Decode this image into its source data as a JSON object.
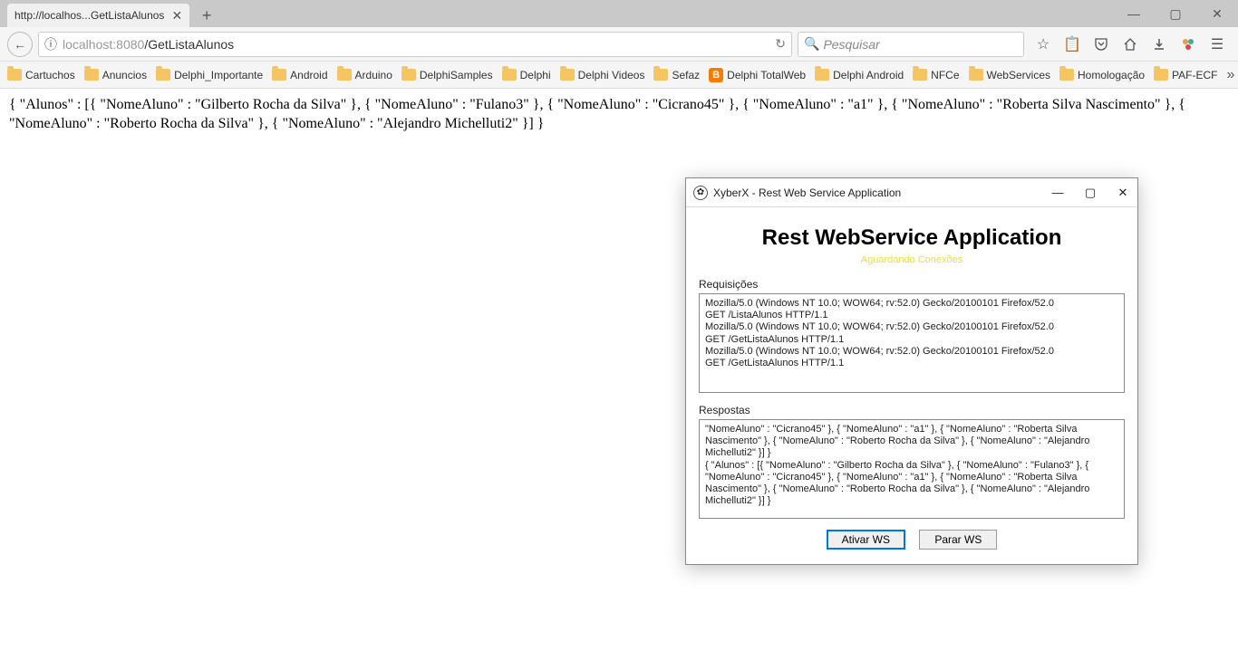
{
  "window": {
    "minimize": "—",
    "maximize": "▢",
    "close": "✕"
  },
  "tab": {
    "title": "http://localhos...GetListaAlunos",
    "close": "✕",
    "new": "+"
  },
  "nav": {
    "back": "←",
    "info_icon": "ⓘ",
    "url_gray1": "localhost",
    "url_gray2": ":8080",
    "url_dark": "/GetListaAlunos",
    "reload": "↻"
  },
  "search": {
    "icon": "🔍",
    "placeholder": "Pesquisar"
  },
  "toolbar": {
    "star": "☆",
    "clipboard": "📋",
    "pocket": "⬇",
    "home": "⌂",
    "download": "⬇",
    "puzzle": "●",
    "menu": "☰"
  },
  "bookmarks": [
    {
      "label": "Cartuchos",
      "kind": "folder"
    },
    {
      "label": "Anuncios",
      "kind": "folder"
    },
    {
      "label": "Delphi_Importante",
      "kind": "folder"
    },
    {
      "label": "Android",
      "kind": "folder"
    },
    {
      "label": "Arduino",
      "kind": "folder"
    },
    {
      "label": "DelphiSamples",
      "kind": "folder"
    },
    {
      "label": "Delphi",
      "kind": "folder"
    },
    {
      "label": "Delphi Videos",
      "kind": "folder"
    },
    {
      "label": "Sefaz",
      "kind": "folder"
    },
    {
      "label": "Delphi TotalWeb",
      "kind": "blogger"
    },
    {
      "label": "Delphi Android",
      "kind": "folder"
    },
    {
      "label": "NFCe",
      "kind": "folder"
    },
    {
      "label": "WebServices",
      "kind": "folder"
    },
    {
      "label": "Homologação",
      "kind": "folder"
    },
    {
      "label": "PAF-ECF",
      "kind": "folder"
    }
  ],
  "bookmarks_overflow": "»",
  "page_content": "{ \"Alunos\" : [{ \"NomeAluno\" : \"Gilberto Rocha da Silva\" }, { \"NomeAluno\" : \"Fulano3\" }, { \"NomeAluno\" : \"Cicrano45\" }, { \"NomeAluno\" : \"a1\" }, { \"NomeAluno\" : \"Roberta Silva Nascimento\" }, { \"NomeAluno\" : \"Roberto Rocha da Silva\" }, { \"NomeAluno\" : \"Alejandro Michelluti2\" }] }",
  "dialog": {
    "title": "XyberX - Rest Web Service Application",
    "heading": "Rest WebService Application",
    "subtitle": "Aguardando Conexões",
    "req_label": "Requisições",
    "requests": "Mozilla/5.0 (Windows NT 10.0; WOW64; rv:52.0) Gecko/20100101 Firefox/52.0\nGET /ListaAlunos HTTP/1.1\nMozilla/5.0 (Windows NT 10.0; WOW64; rv:52.0) Gecko/20100101 Firefox/52.0\nGET /GetListaAlunos HTTP/1.1\nMozilla/5.0 (Windows NT 10.0; WOW64; rv:52.0) Gecko/20100101 Firefox/52.0\nGET /GetListaAlunos HTTP/1.1",
    "resp_label": "Respostas",
    "responses": "\"NomeAluno\" : \"Cicrano45\" }, { \"NomeAluno\" : \"a1\" }, { \"NomeAluno\" : \"Roberta Silva Nascimento\" }, { \"NomeAluno\" : \"Roberto Rocha da Silva\" }, { \"NomeAluno\" : \"Alejandro Michelluti2\" }] }\n{ \"Alunos\" : [{ \"NomeAluno\" : \"Gilberto Rocha da Silva\" }, { \"NomeAluno\" : \"Fulano3\" }, { \"NomeAluno\" : \"Cicrano45\" }, { \"NomeAluno\" : \"a1\" }, { \"NomeAluno\" : \"Roberta Silva Nascimento\" }, { \"NomeAluno\" : \"Roberto Rocha da Silva\" }, { \"NomeAluno\" : \"Alejandro Michelluti2\" }] }",
    "btn_ativar": "Ativar WS",
    "btn_parar": "Parar WS",
    "win": {
      "min": "—",
      "max": "▢",
      "close": "✕"
    }
  }
}
